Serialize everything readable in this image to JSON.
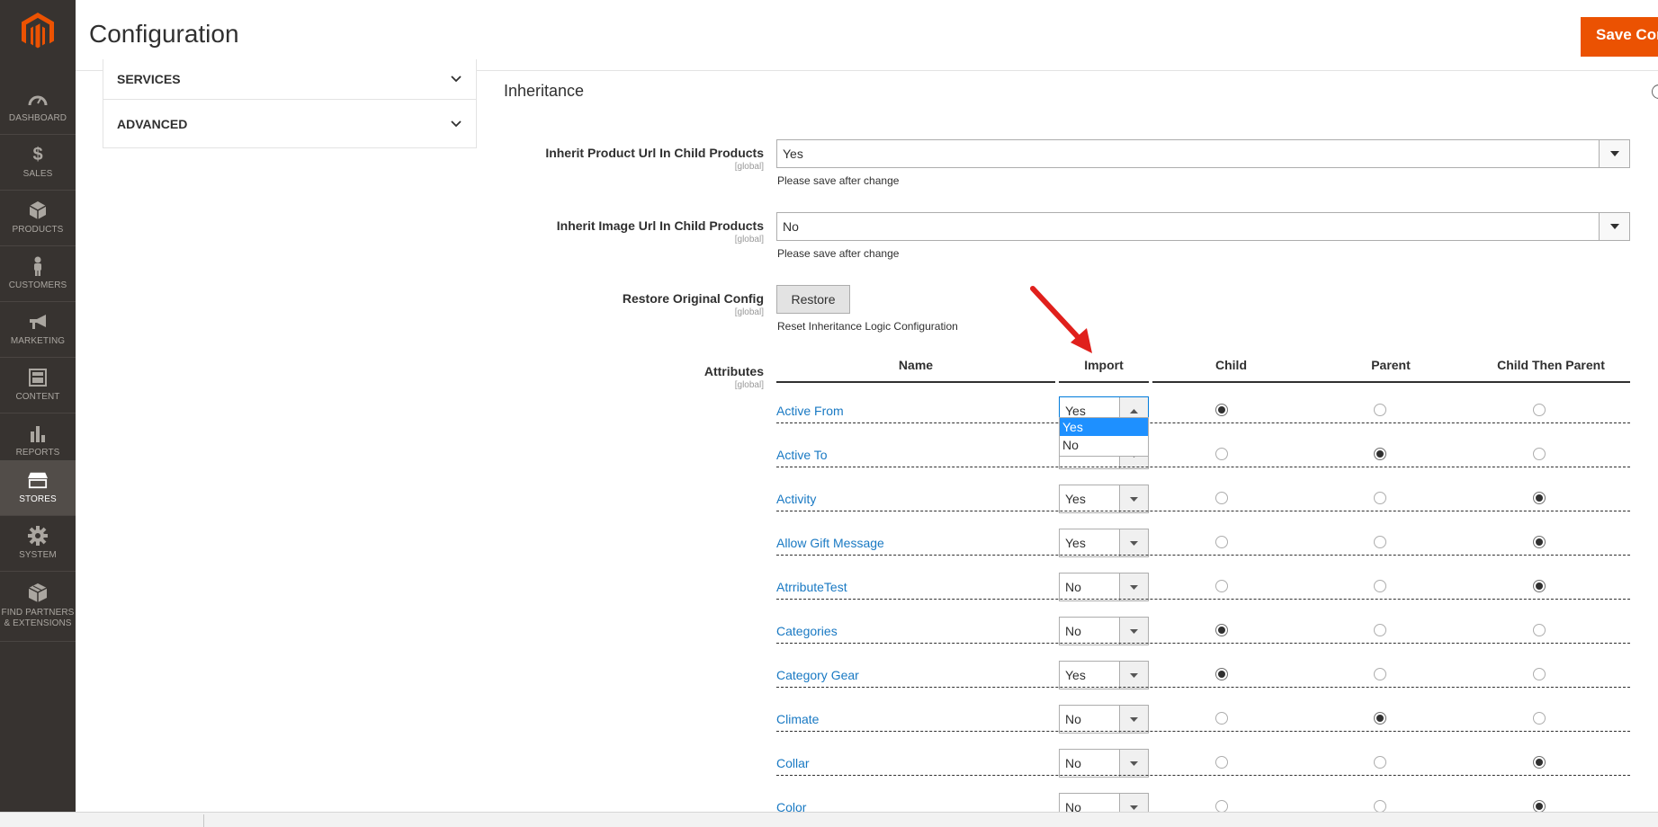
{
  "nav": {
    "items": [
      {
        "label": "DASHBOARD",
        "icon": "dashboard-icon"
      },
      {
        "label": "SALES",
        "icon": "dollar-icon"
      },
      {
        "label": "PRODUCTS",
        "icon": "cube-icon"
      },
      {
        "label": "CUSTOMERS",
        "icon": "person-icon"
      },
      {
        "label": "MARKETING",
        "icon": "megaphone-icon"
      },
      {
        "label": "CONTENT",
        "icon": "layout-icon"
      },
      {
        "label": "REPORTS",
        "icon": "bar-chart-icon"
      },
      {
        "label": "STORES",
        "icon": "store-icon"
      },
      {
        "label": "SYSTEM",
        "icon": "gear-icon"
      },
      {
        "label": "FIND PARTNERS & EXTENSIONS",
        "icon": "boxes-icon"
      }
    ],
    "active": "STORES",
    "accent": "#eb5202"
  },
  "header": {
    "title": "Configuration",
    "save_label": "Save Config"
  },
  "tabs": [
    {
      "label": "SERVICES"
    },
    {
      "label": "ADVANCED"
    }
  ],
  "section": {
    "title": "Inheritance"
  },
  "fields": {
    "inherit_url": {
      "label": "Inherit Product Url In Child Products",
      "scope": "[global]",
      "value": "Yes",
      "note": "Please save after change"
    },
    "inherit_image": {
      "label": "Inherit Image Url In Child Products",
      "scope": "[global]",
      "value": "No",
      "note": "Please save after change"
    },
    "restore": {
      "label": "Restore Original Config",
      "scope": "[global]",
      "button": "Restore",
      "note": "Reset Inheritance Logic Configuration"
    },
    "attributes": {
      "label": "Attributes",
      "scope": "[global]"
    }
  },
  "table": {
    "headers": {
      "name": "Name",
      "import": "Import",
      "child": "Child",
      "parent": "Parent",
      "child_then_parent": "Child Then Parent"
    },
    "rows": [
      {
        "name": "Active From",
        "import": "Yes",
        "choice": "child"
      },
      {
        "name": "Active To",
        "import": "",
        "choice": "parent"
      },
      {
        "name": "Activity",
        "import": "Yes",
        "choice": "child_then_parent"
      },
      {
        "name": "Allow Gift Message",
        "import": "Yes",
        "choice": "child_then_parent"
      },
      {
        "name": "AtrributeTest",
        "import": "No",
        "choice": "child_then_parent"
      },
      {
        "name": "Categories",
        "import": "No",
        "choice": "child"
      },
      {
        "name": "Category Gear",
        "import": "Yes",
        "choice": "child"
      },
      {
        "name": "Climate",
        "import": "No",
        "choice": "parent"
      },
      {
        "name": "Collar",
        "import": "No",
        "choice": "child_then_parent"
      },
      {
        "name": "Color",
        "import": "No",
        "choice": "child_then_parent"
      }
    ],
    "dropdown_options": [
      "Yes",
      "No"
    ],
    "dropdown_selected": "Yes"
  }
}
